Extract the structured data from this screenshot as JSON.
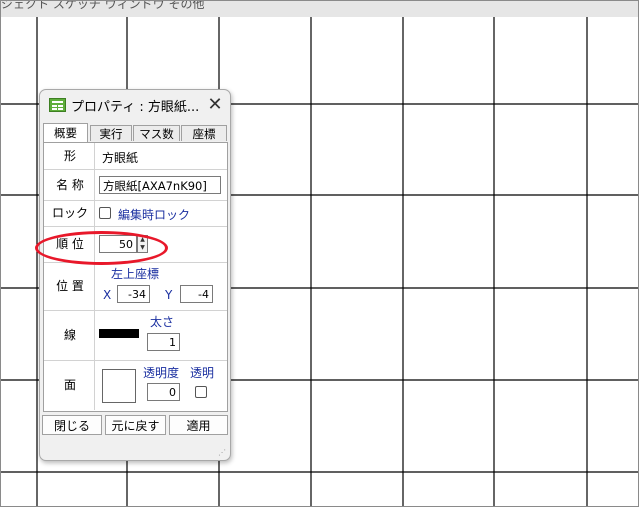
{
  "background": {
    "top_strip_text": "ジェクト スケッチ ウィンドウ その他",
    "grid_line_color": "#000000"
  },
  "dialog": {
    "title": "プロパティ : 方眼紙...",
    "app_icon": "table-icon",
    "close_label": "✕",
    "tabs": [
      {
        "label": "概要",
        "active": true
      },
      {
        "label": "実行",
        "active": false
      },
      {
        "label": "マス数",
        "active": false
      },
      {
        "label": "座標",
        "active": false
      }
    ],
    "shape": {
      "label": "形",
      "value": "方眼紙"
    },
    "name": {
      "label": "名 称",
      "value": "方眼紙[AXA7nK90]"
    },
    "lock": {
      "label": "ロック",
      "checkbox_label": "編集時ロック",
      "checked": false
    },
    "order": {
      "label": "順 位",
      "value": "50"
    },
    "position": {
      "label": "位 置",
      "heading": "左上座標",
      "x_label": "X",
      "x_value": "-34",
      "y_label": "Y",
      "y_value": "-4"
    },
    "line": {
      "label": "線",
      "width_label": "太さ",
      "width_value": "1",
      "color": "#000000"
    },
    "fill": {
      "label": "面",
      "opacity_label": "透明度",
      "opacity_value": "0",
      "transparent_label": "透明",
      "transparent_checked": false,
      "color": "#ffffff"
    },
    "buttons": {
      "close": "閉じる",
      "revert": "元に戻す",
      "apply": "適用"
    }
  },
  "annotation": {
    "color": "#e8182a",
    "target": "順位"
  }
}
